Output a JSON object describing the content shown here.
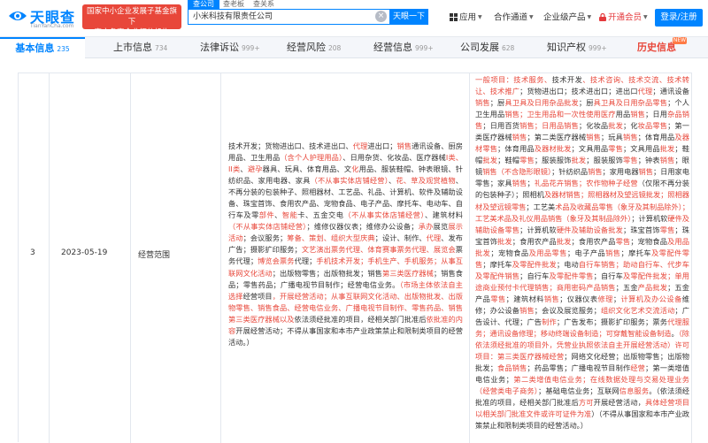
{
  "header": {
    "logo_text": "天眼查",
    "logo_sub": "TianYanCha.com",
    "badge_line1": "国家中小企业发展子基金旗下",
    "badge_line2": "官方备案企业征信机构",
    "search_tabs": [
      "查公司",
      "查老板",
      "查关系"
    ],
    "search_value": "小米科技有限责任公司",
    "clear_icon": "×",
    "search_button": "天眼一下",
    "nav": [
      {
        "label": "应用",
        "icon": "grid-icon"
      },
      {
        "label": "合作通道",
        "icon": ""
      },
      {
        "label": "企业级产品",
        "icon": ""
      },
      {
        "label": "开通会员",
        "icon": "lock-icon"
      }
    ],
    "login_button": "登录/注册"
  },
  "tabs": [
    {
      "label": "基本信息",
      "count": "235"
    },
    {
      "label": "上市信息",
      "count": "734"
    },
    {
      "label": "法律诉讼",
      "count": "999+"
    },
    {
      "label": "经营风险",
      "count": "208"
    },
    {
      "label": "经营信息",
      "count": "999+"
    },
    {
      "label": "公司发展",
      "count": "628"
    },
    {
      "label": "知识产权",
      "count": "999+"
    },
    {
      "label": "历史信息",
      "count": ""
    }
  ],
  "new_badge": "NEW",
  "row": {
    "index": "3",
    "date": "2023-05-19",
    "field": "经营范围"
  },
  "colors": {
    "accent": "#0084ff",
    "highlight": "#e8473a"
  }
}
